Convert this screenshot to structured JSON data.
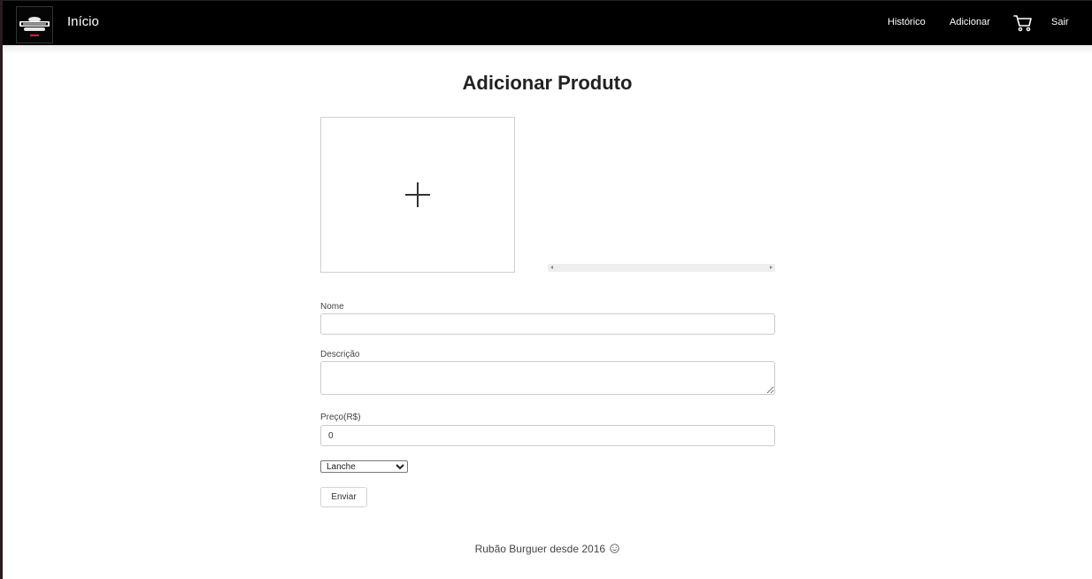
{
  "navbar": {
    "brand": "Início",
    "links": {
      "historico": "Histórico",
      "adicionar": "Adicionar",
      "sair": "Sair"
    },
    "icons": {
      "logo": "rubao-burguer-logo",
      "cart": "cart-icon"
    }
  },
  "main": {
    "title": "Adicionar Produto",
    "image_upload": {
      "icon": "plus-icon"
    },
    "form": {
      "nome": {
        "label": "Nome",
        "value": ""
      },
      "descricao": {
        "label": "Descrição",
        "value": ""
      },
      "preco": {
        "label": "Preço(R$)",
        "value": "0"
      },
      "categoria": {
        "selected": "Lanche"
      },
      "submit_label": "Enviar"
    }
  },
  "footer": {
    "text": "Rubão Burguer desde 2016",
    "icon": "smile-icon"
  },
  "colors": {
    "navbar_bg": "#000000",
    "page_bg": "#ffffff",
    "text": "#222222"
  }
}
